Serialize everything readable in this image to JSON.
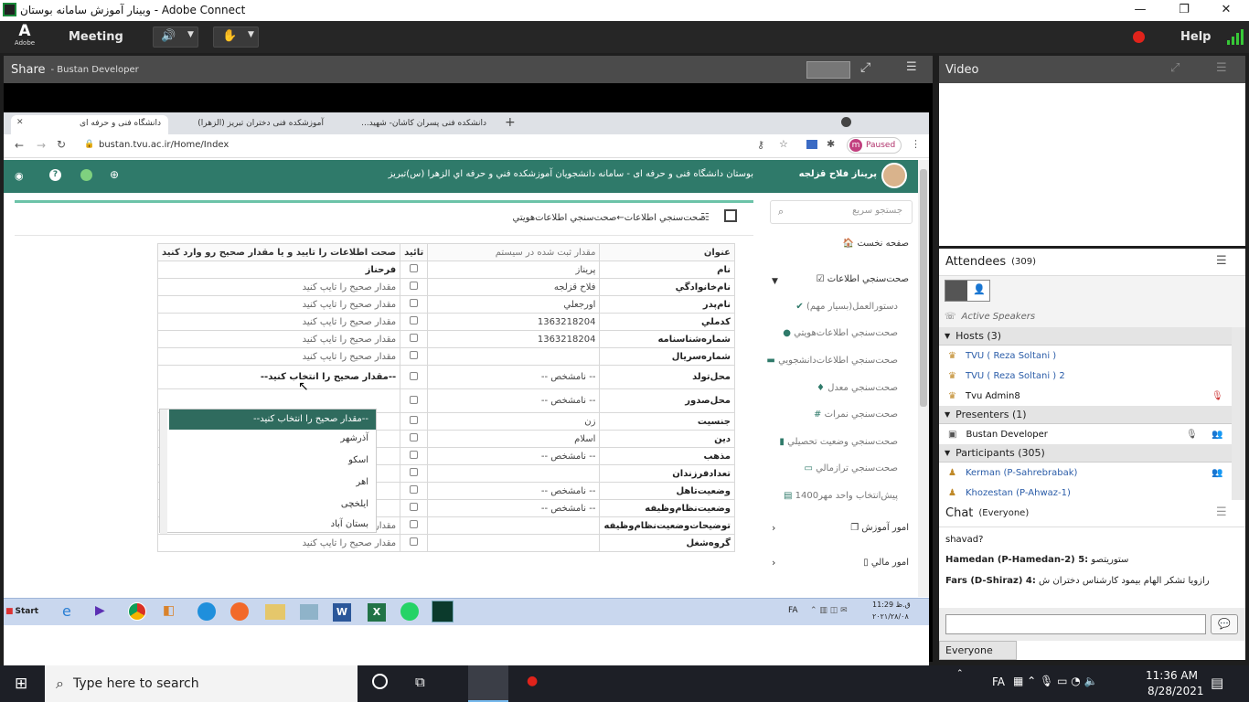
{
  "window": {
    "title": "وبینار آموزش سامانه بوستان - Adobe Connect",
    "controls": [
      "—",
      "❐",
      "✕"
    ]
  },
  "menubar": {
    "logo": "Adobe",
    "meeting": "Meeting",
    "help": "Help"
  },
  "share": {
    "title": "Share",
    "presenter": "- Bustan Developer"
  },
  "browser": {
    "tabs": [
      {
        "label": "دانشگاه فنی و حرفه ای"
      },
      {
        "label": "آموزشکده فنی دختران تبریز (الزهرا)"
      },
      {
        "label": "دانشکده فنی پسران کاشان- شهید..."
      }
    ],
    "url": "bustan.tvu.ac.ir/Home/Index",
    "paused": "Paused",
    "profile": "m"
  },
  "site": {
    "user": "پریناز فلاح قزلجه",
    "title": "بوستان دانشگاه فنی و حرفه ای - سامانه دانشجويان آموزشکده فني و حرفه اي الزهرا (س)تبريز",
    "search_placeholder": "جستجو سریع",
    "breadcrumb": "صحت‌سنجي اطلاعات←صحت‌سنجي اطلاعات‌هويتي",
    "menu": {
      "home": "صفحه نخست",
      "verify": "صحت‌سنجي اطلاعات",
      "sub": [
        "دستورالعمل(بسيار مهم)",
        "صحت‌سنجي اطلاعات‌هويتي",
        "صحت‌سنجي اطلاعات‌دانشجويي",
        "صحت‌سنجي معدل",
        "صحت‌سنجي نمرات",
        "صحت‌سنجي وضعيت تحصيلي",
        "صحت‌سنجي ترازمالي",
        "پيش‌انتخاب واحد مهر1400"
      ],
      "education": "امور آموزش",
      "finance": "امور مالي"
    }
  },
  "table": {
    "headers": {
      "title": "عنوان",
      "registered": "مقدار ثبت شده در سیستم",
      "confirm": "تائید",
      "correct": "صحت اطلاعات را تایید و یا مقدار صحیح رو وارد کنید"
    },
    "rows": [
      {
        "title": "نام",
        "value": "پريناز",
        "correct": "فرحناز",
        "mode": "bold"
      },
      {
        "title": "نام‌خانوادگي",
        "value": "فلاح قزلجه",
        "correct": "مقدار صحیح را تایپ کنید",
        "mode": "ph"
      },
      {
        "title": "نام‌پدر",
        "value": "اورجعلي",
        "correct": "مقدار صحیح را تایپ کنید",
        "mode": "ph"
      },
      {
        "title": "کدملي",
        "value": "1363218204",
        "correct": "مقدار صحیح را تایپ کنید",
        "mode": "ph"
      },
      {
        "title": "شماره‌شناسنامه",
        "value": "1363218204",
        "correct": "مقدار صحیح را تایپ کنید",
        "mode": "ph"
      },
      {
        "title": "شماره‌سريال",
        "value": "",
        "correct": "مقدار صحیح را تایپ کنید",
        "mode": "ph"
      },
      {
        "title": "محل‌تولد",
        "value": "-- نامشخص --",
        "correct": "--مقدار صحیح را انتخاب کنید--",
        "mode": "select"
      },
      {
        "title": "محل‌صدور",
        "value": "-- نامشخص --",
        "correct": "",
        "mode": "input"
      },
      {
        "title": "جنسيت",
        "value": "زن",
        "correct": "",
        "mode": "list"
      },
      {
        "title": "دين",
        "value": "اسلام",
        "correct": "",
        "mode": "list"
      },
      {
        "title": "مذهب",
        "value": "-- نامشخص --",
        "correct": "",
        "mode": "list"
      },
      {
        "title": "تعدادفرزندان",
        "value": "",
        "correct": "",
        "mode": "list"
      },
      {
        "title": "وضعيت‌تاهل",
        "value": "-- نامشخص --",
        "correct": "",
        "mode": "list"
      },
      {
        "title": "وضعيت‌نظام‌وظيفه",
        "value": "-- نامشخص --",
        "correct": "",
        "mode": "list"
      },
      {
        "title": "توضيحات‌وضعيت‌نظام‌وظيفه",
        "value": "",
        "correct": "مقدار صحیح را تایپ کنید",
        "mode": "ph"
      },
      {
        "title": "گروه‌شغل",
        "value": "",
        "correct": "مقدار صحیح را تایپ کنید",
        "mode": "ph"
      }
    ],
    "dropdown": {
      "selected": "--مقدار صحیح را انتخاب کنید--",
      "options": [
        "آذرشهر",
        "اسکو",
        "اهر",
        "ایلخچی",
        "بستان آباد"
      ]
    }
  },
  "wintask": {
    "start": "Start",
    "lang": "FA",
    "time": "11:29 ق.ظ",
    "date": "۲۰۲۱/۲۸/۰۸"
  },
  "video": {
    "title": "Video"
  },
  "attendees": {
    "title": "Attendees",
    "count": "(309)",
    "active_speakers": "Active Speakers",
    "hosts_label": "Hosts (3)",
    "hosts": [
      "TVU ( Reza Soltani )",
      "TVU ( Reza Soltani ) 2",
      "Tvu Admin8"
    ],
    "presenters_label": "Presenters (1)",
    "presenters": [
      "Bustan Developer"
    ],
    "participants_label": "Participants (305)",
    "participants": [
      "Kerman (P-Sahrebrabak)",
      "Khozestan (P-Ahwaz-1)"
    ]
  },
  "chat": {
    "title": "Chat",
    "scope": "(Everyone)",
    "messages": [
      {
        "sender": "",
        "text": "shavad?"
      },
      {
        "sender": "Hamedan (P-Hamedan-2) 5:",
        "text": "ستوریتصو"
      },
      {
        "sender": "Fars (D-Shiraz) 4:",
        "text": "رازویا تشکر الهام بیمود کارشناس دختران ش"
      }
    ],
    "target": "Everyone"
  },
  "taskbar": {
    "search_placeholder": "Type here to search",
    "lang": "FA",
    "time": "11:36 AM",
    "date": "8/28/2021"
  },
  "colors": {
    "site_green": "#2f7a6a",
    "connect_dark": "#262626",
    "record_red": "#e0231b",
    "link_blue": "#2a5ca8"
  }
}
